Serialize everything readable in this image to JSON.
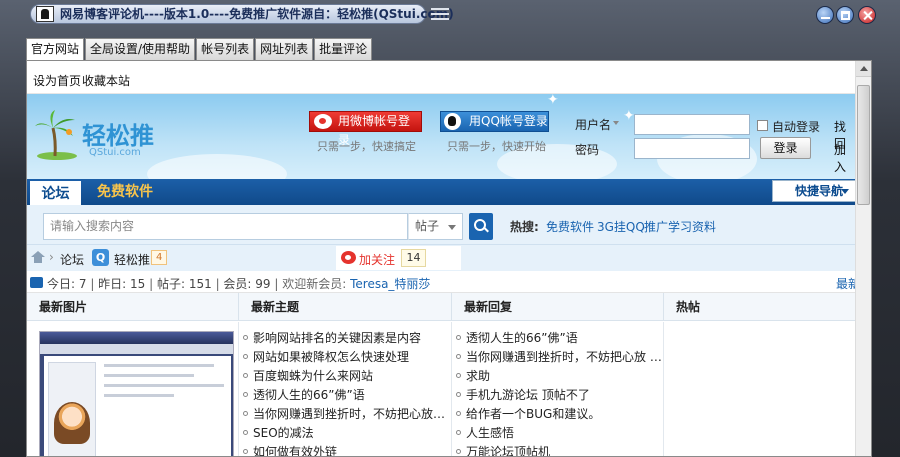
{
  "window": {
    "title": "网易博客评论机----版本1.0----免费推广软件源自：轻松推(QStui.com)"
  },
  "tabs": [
    "官方网站",
    "全局设置/使用帮助",
    "帐号列表",
    "网址列表",
    "批量评论"
  ],
  "linkbar": {
    "set_home": "设为首页",
    "bookmark": "收藏本站"
  },
  "header": {
    "site_name": "轻松推",
    "site_domain": "QStui.com",
    "weibo_login": "用微博帐号登录",
    "qq_login": "用QQ帐号登录",
    "weibo_hint": "只需一步，快速搞定",
    "qq_hint": "只需一步，快速开始",
    "username_label": "用户名",
    "password_label": "密码",
    "auto_login": "自动登录",
    "login_button": "登录",
    "edge_top": "找回",
    "edge_bottom": "加入"
  },
  "nav": {
    "forum": "论坛",
    "free_software": "免费软件",
    "quick_nav": "快捷导航"
  },
  "search": {
    "placeholder": "请输入搜索内容",
    "type": "帖子",
    "hot_label": "热搜:",
    "hot_links": [
      "免费软件",
      "3G挂QQ",
      "推广学习资料"
    ]
  },
  "breadcrumb": {
    "forum": "论坛",
    "user": "轻松推",
    "count": "4",
    "follow_label": "加关注",
    "follow_count": "14"
  },
  "stats": {
    "today": "今日: 7",
    "yesterday": "昨日: 15",
    "posts": "帖子: 151",
    "members": "会员: 99",
    "welcome": "欢迎新会员: ",
    "new_member": "Teresa_特丽莎",
    "right_text": "最新"
  },
  "columns": {
    "images_title": "最新图片",
    "topics_title": "最新主题",
    "replies_title": "最新回复",
    "hot_title": "热帖",
    "topics": [
      "影响网站排名的关键因素是内容",
      "网站如果被降权怎么快速处理",
      "百度蜘蛛为什么来网站",
      "透彻人生的66”佛”语",
      "当你网赚遇到挫折时，不妨把心放…",
      "SEO的减法",
      "如何做有效外链"
    ],
    "replies": [
      "透彻人生的66”佛”语",
      "当你网赚遇到挫折时，不妨把心放 …",
      "求助",
      "手机九游论坛  顶帖不了",
      "给作者一个BUG和建议。",
      "人生感悟",
      "万能论坛顶帖机"
    ]
  },
  "colors": {
    "nav_blue": "#1c5fa8",
    "free_gold": "#f8c44b",
    "weibo_red": "#e5332d",
    "link_blue": "#1a64b0"
  }
}
